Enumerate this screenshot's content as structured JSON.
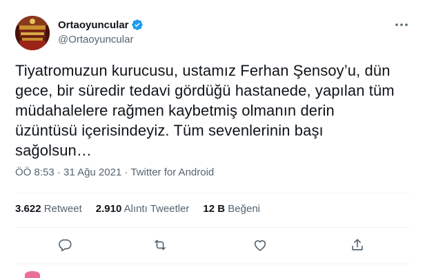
{
  "author": {
    "display_name": "Ortaoyuncular",
    "handle": "@Ortaoyuncular",
    "verified": true,
    "avatar_icon": "theater-avatar-icon"
  },
  "tweet": {
    "lines": [
      "Tiyatromuzun kurucusu, ustamız Ferhan Şensoy’u, dün",
      "gece, bir süredir tedavi gördüğü hastanede, yapılan tüm",
      "müdahalelere rağmen kaybetmiş olmanın derin",
      "üzüntüsü içerisindeyiz. Tüm sevenlerinin başı",
      "sağolsun…"
    ]
  },
  "meta": {
    "time": "ÖÖ 8:53",
    "separator": " · ",
    "date": "31 Ağu 2021",
    "source": "Twitter for Android"
  },
  "stats": {
    "retweets": {
      "count": "3.622",
      "label": "Retweet"
    },
    "quotes": {
      "count": "2.910",
      "label": "Alıntı Tweetler"
    },
    "likes": {
      "count": "12 B",
      "label": "Beğeni"
    }
  },
  "actions": {
    "reply_icon": "reply-icon",
    "retweet_icon": "retweet-icon",
    "like_icon": "heart-icon",
    "share_icon": "share-icon",
    "more_icon": "more-dots-icon"
  },
  "colors": {
    "text": "#0f1419",
    "secondary": "#536471",
    "verified": "#1d9bf0",
    "divider": "#eff3f4"
  }
}
